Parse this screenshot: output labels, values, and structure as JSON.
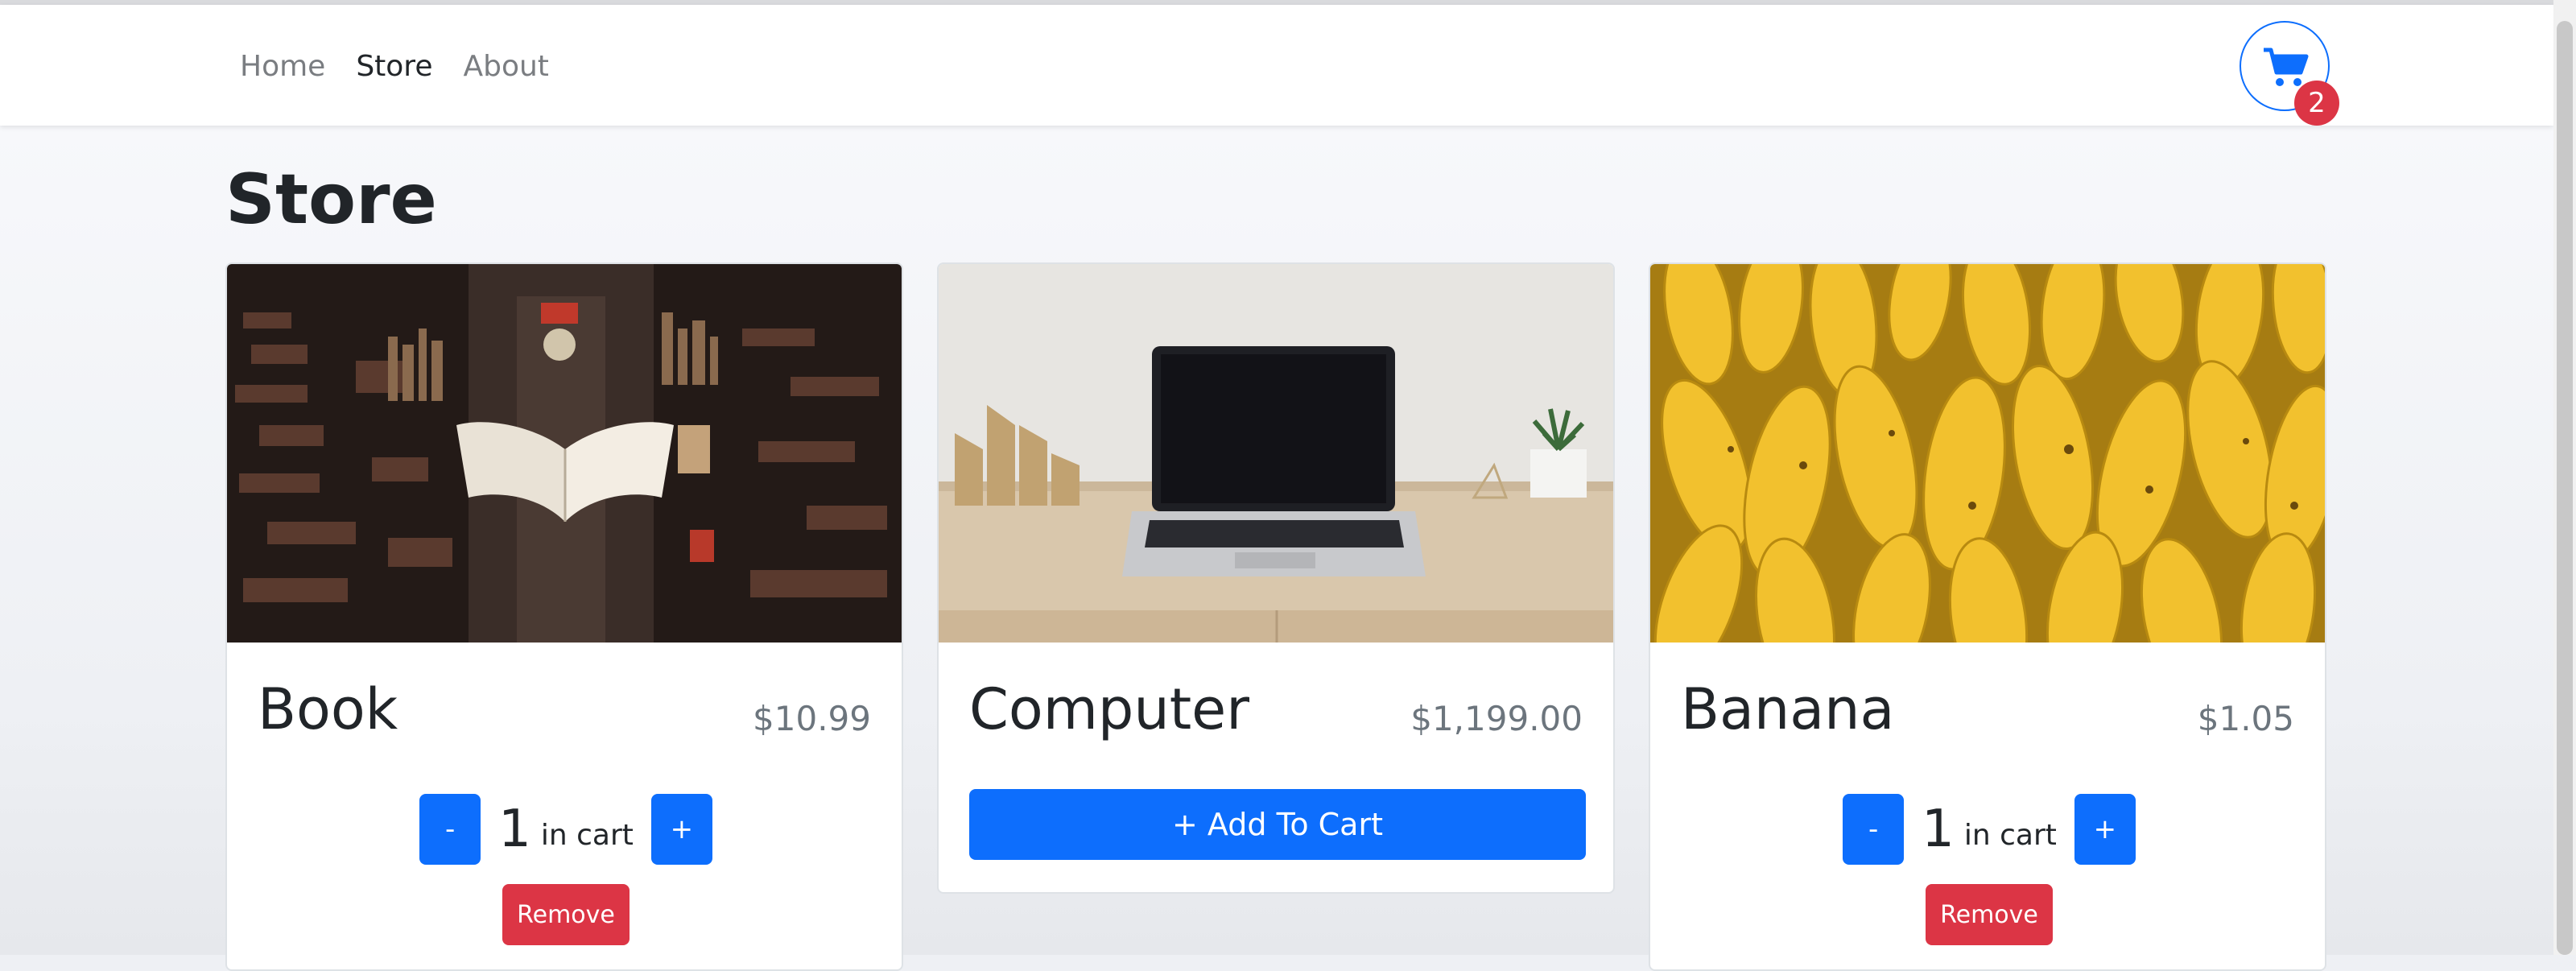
{
  "nav": {
    "links": [
      "Home",
      "Store",
      "About"
    ],
    "active": "Store",
    "cart_count": "2"
  },
  "page": {
    "title": "Store"
  },
  "products": [
    {
      "name": "Book",
      "price": "$10.99",
      "quantity": "1",
      "in_cart_label": "in cart",
      "minus_label": "-",
      "plus_label": "+",
      "remove_label": "Remove"
    },
    {
      "name": "Computer",
      "price": "$1,199.00",
      "add_label": "+ Add To Cart"
    },
    {
      "name": "Banana",
      "price": "$1.05",
      "quantity": "1",
      "in_cart_label": "in cart",
      "minus_label": "-",
      "plus_label": "+",
      "remove_label": "Remove"
    }
  ],
  "colors": {
    "primary": "#0d6efd",
    "danger": "#dc3545"
  }
}
